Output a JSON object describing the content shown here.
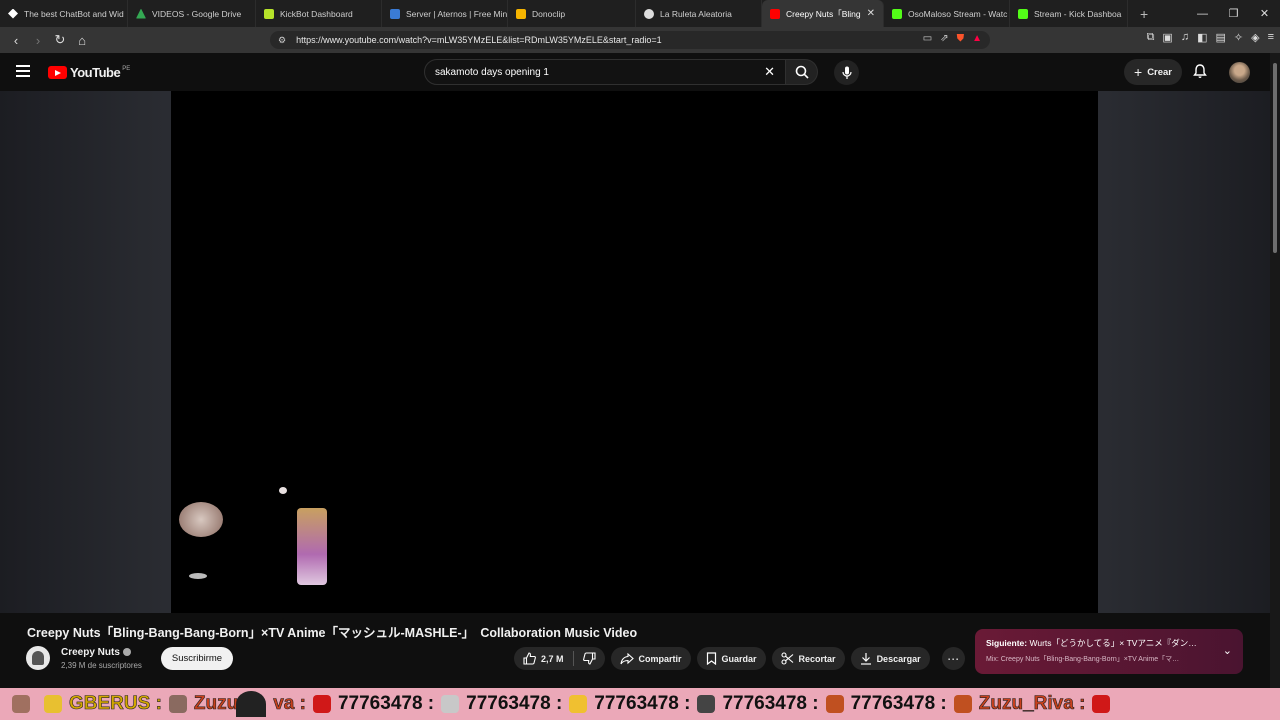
{
  "browser": {
    "tabs": [
      {
        "label": "The best ChatBot and Wid",
        "color": "#ffffff"
      },
      {
        "label": "VIDEOS - Google Drive",
        "color": "#34a853"
      },
      {
        "label": "KickBot Dashboard",
        "color": "#b6e32a"
      },
      {
        "label": "Server | Aternos | Free Min",
        "color": "#3a7bd5"
      },
      {
        "label": "Donoclip",
        "color": "#f5b400"
      },
      {
        "label": "La Ruleta Aleatoria",
        "color": "#dddddd"
      },
      {
        "label": "Creepy Nuts「Bling",
        "color": "#ff0000"
      },
      {
        "label": "OsoMaloso Stream - Watc",
        "color": "#53fc18"
      },
      {
        "label": "Stream - Kick Dashboa",
        "color": "#53fc18"
      }
    ],
    "url": "https://www.youtube.com/watch?v=mLW35YMzELE&list=RDmLW35YMzELE&start_radio=1"
  },
  "youtube": {
    "logo_text": "YouTube",
    "country": "PE",
    "search_query": "sakamoto days opening 1",
    "create_label": "Crear"
  },
  "video": {
    "title": "Creepy Nuts「Bling-Bang-Bang-Born」×TV Anime「マッシュル-MASHLE-」　Collaboration Music Video",
    "channel": "Creepy Nuts",
    "subscribers": "2,39 M de suscriptores",
    "subscribe_label": "Suscribirme",
    "likes": "2,7 M",
    "share_label": "Compartir",
    "save_label": "Guardar",
    "clip_label": "Recortar",
    "download_label": "Descargar"
  },
  "next": {
    "prefix": "Siguiente:",
    "title": "Wurts「どうかしてる」× TVアニメ『ダン…",
    "subtitle": "Mix: Creepy Nuts「Bling-Bang-Bang-Born」×TV Anime「マ…"
  },
  "overlay": {
    "items": [
      "GBERUS :",
      "Zuzu",
      "va :",
      "77763478 :",
      "77763478 :",
      "77763478 :",
      "77763478 :",
      "77763478 :",
      "Zuzu_Riva :"
    ]
  }
}
